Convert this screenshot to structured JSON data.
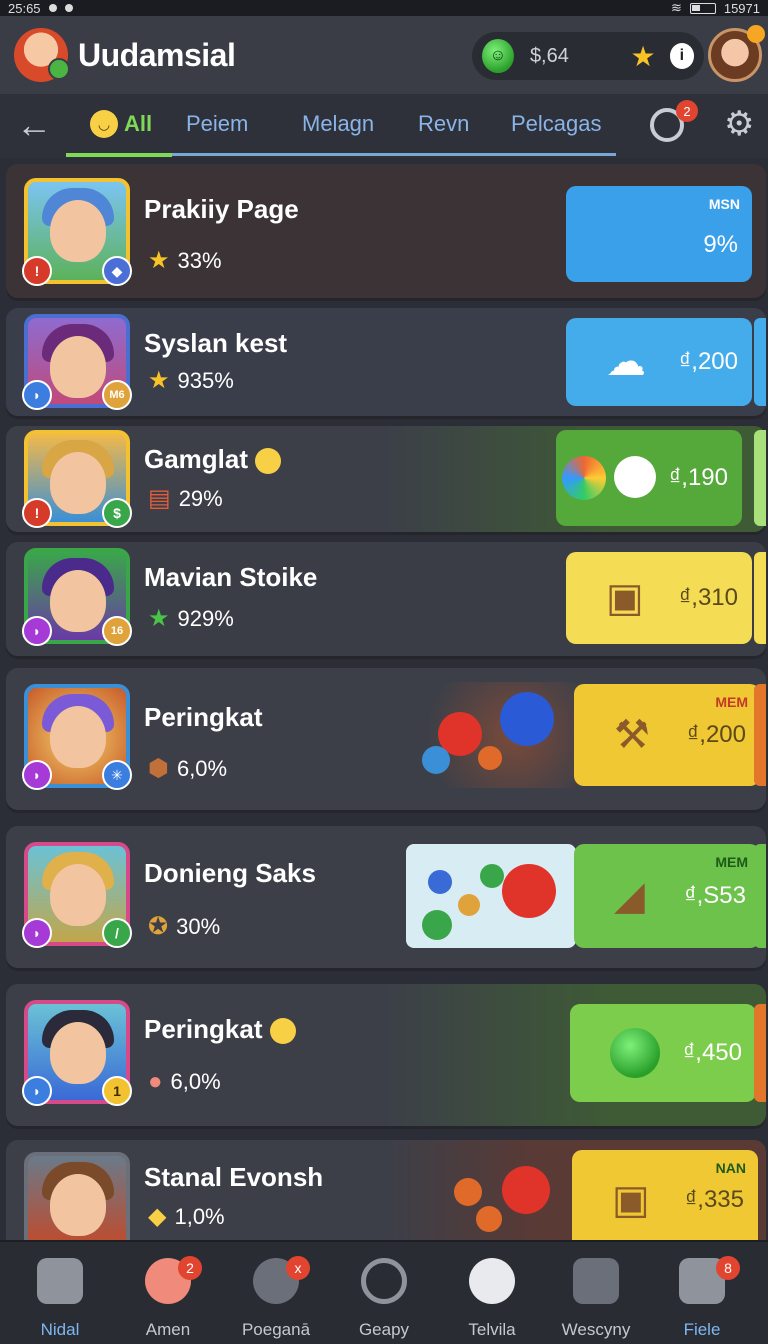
{
  "status": {
    "time": "25:65",
    "right_text": "15971"
  },
  "header": {
    "app_title": "Uudamsial",
    "wallet_amount": "$,64",
    "coin_icon": "green-coin-icon",
    "star_icon": "star-icon",
    "info_glyph": "i"
  },
  "tabs": [
    {
      "label": "All",
      "active": true
    },
    {
      "label": "Peiem",
      "active": false
    },
    {
      "label": "Melagn",
      "active": false
    },
    {
      "label": "Revn",
      "active": false
    },
    {
      "label": "Pelcagas",
      "active": false
    }
  ],
  "history_badge": "2",
  "rows": [
    {
      "name": "Prakiiy Page",
      "stat": "33%",
      "stat_icon": "star",
      "reward_tag": "MSN",
      "reward_value": "9%",
      "reward_color": "#3aa0ea"
    },
    {
      "name": "Syslan kest",
      "stat": "935%",
      "stat_icon": "star",
      "reward_tag": "",
      "reward_value": "₫,200",
      "reward_color": "#45acec"
    },
    {
      "name": "Gamglat",
      "stat": "29%",
      "stat_icon": "card",
      "reward_tag": "",
      "reward_value": "₫,190",
      "reward_color": "#55a83a"
    },
    {
      "name": "Mavian Stoike",
      "stat": "929%",
      "stat_icon": "green-star",
      "reward_tag": "",
      "reward_value": "₫,310",
      "reward_color": "#f4dc55"
    },
    {
      "name": "Peringkat",
      "stat": "6,0%",
      "stat_icon": "bag",
      "reward_tag": "MEM",
      "reward_value": "₫,200",
      "reward_color": "#f0c833"
    },
    {
      "name": "Donieng Saks",
      "stat": "30%",
      "stat_icon": "medal",
      "reward_tag": "MEM",
      "reward_value": "₫,S53",
      "reward_color": "#6cc24a"
    },
    {
      "name": "Peringkat",
      "stat": "6,0%",
      "stat_icon": "pig",
      "reward_tag": "",
      "reward_value": "₫,450",
      "reward_color": "#7dcd4c"
    },
    {
      "name": "Stanal Evonsh",
      "stat": "1,0%",
      "stat_icon": "duck",
      "reward_tag": "NAN",
      "reward_value": "₫,335",
      "reward_color": "#f0c833"
    }
  ],
  "nav": [
    {
      "label": "Nidal",
      "active": true,
      "badge": ""
    },
    {
      "label": "Amen",
      "active": false,
      "badge": "2"
    },
    {
      "label": "Poeganā",
      "active": false,
      "badge": "x"
    },
    {
      "label": "Geapy",
      "active": false,
      "badge": ""
    },
    {
      "label": "Telvila",
      "active": false,
      "badge": ""
    },
    {
      "label": "Wescyny",
      "active": false,
      "badge": ""
    },
    {
      "label": "Fiele",
      "active": true,
      "badge": "8"
    }
  ]
}
